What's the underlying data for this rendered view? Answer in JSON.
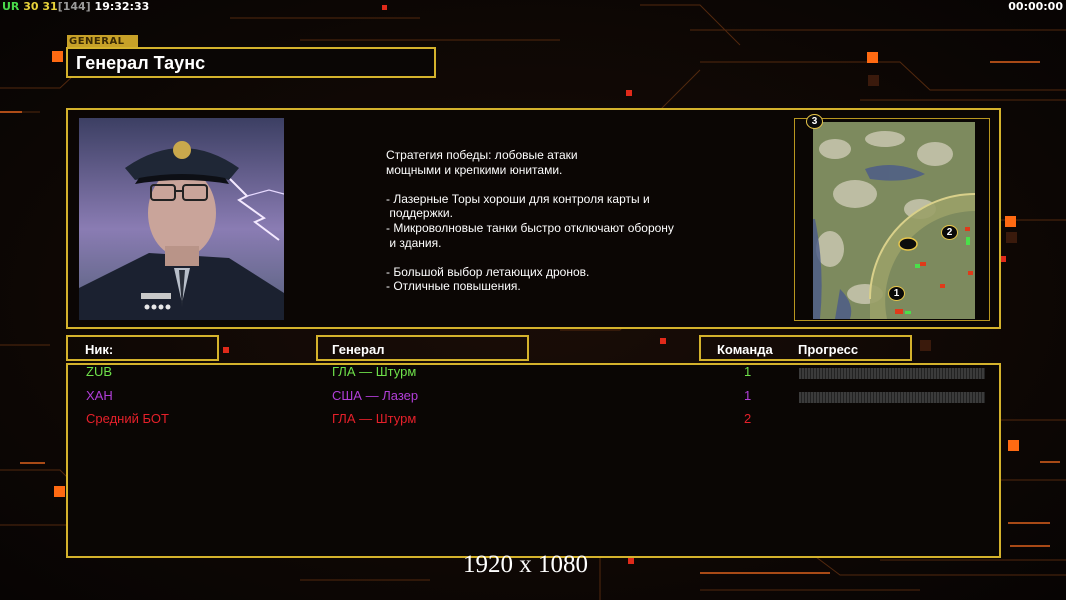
{
  "hud": {
    "left_segments": [
      {
        "text": "UR",
        "color": "#4ad94a"
      },
      {
        "text": " 30",
        "color": "#e8d23a"
      },
      {
        "text": " 31",
        "color": "#e8d23a"
      },
      {
        "text": "[144]",
        "color": "#9a9a9a"
      },
      {
        "text": " 19:32:33",
        "color": "#ffffff"
      }
    ],
    "right_time": "00:00:00"
  },
  "general": {
    "tag": "GENERAL",
    "name": "Генерал Таунс"
  },
  "description": "Стратегия победы: лобовые атаки\nмощными и крепкими юнитами.\n\n- Лазерные Торы хороши для контроля карты и\n поддержки.\n- Микроволновые танки быстро отключают оборону\n и здания.\n\n- Большой выбор летающих дронов.\n- Отличные повышения.",
  "map": {
    "markers": [
      "3",
      "2",
      "1"
    ]
  },
  "table": {
    "headers": {
      "nick": "Ник:",
      "general": "Генерал",
      "team": "Команда",
      "progress": "Прогресс"
    },
    "rows": [
      {
        "nick": "ZUB",
        "general": "ГЛА — Штурм",
        "team": "1",
        "color": "#6ee04a",
        "progress": 0
      },
      {
        "nick": "ХАН",
        "general": "США — Лазер",
        "team": "1",
        "color": "#b13ed8",
        "progress": 0
      },
      {
        "nick": "Средний БОТ",
        "general": "ГЛА — Штурм",
        "team": "2",
        "color": "#e5202a",
        "progress": null
      }
    ]
  },
  "resolution_text": "1920 x 1080",
  "colors": {
    "accent": "#d4b22c",
    "circuit": "#ff7a1a"
  }
}
